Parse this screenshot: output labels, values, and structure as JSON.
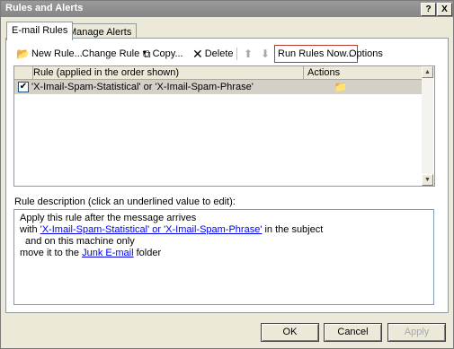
{
  "window": {
    "title": "Rules and Alerts",
    "help_label": "?",
    "close_label": "X"
  },
  "tabs": [
    {
      "label": "E-mail Rules",
      "active": true
    },
    {
      "label": "Manage Alerts",
      "active": false
    }
  ],
  "toolbar": {
    "new_rule": "New Rule...",
    "change_rule": "Change Rule",
    "copy": "Copy...",
    "delete": "Delete",
    "run_rules_now": "Run Rules Now...",
    "options": "Options"
  },
  "rules_list": {
    "columns": [
      "Rule (applied in the order shown)",
      "Actions"
    ],
    "rows": [
      {
        "checked": true,
        "rule": "'X-Imail-Spam-Statistical' or 'X-Imail-Spam-Phrase'"
      }
    ]
  },
  "description": {
    "label": "Rule description (click an underlined value to edit):",
    "line1": "Apply this rule after the message arrives",
    "line2_prefix": "with ",
    "line2_link": "'X-Imail-Spam-Statistical' or 'X-Imail-Spam-Phrase'",
    "line2_suffix": " in the subject",
    "line3": "and on this machine only",
    "line4_prefix": "move it to the ",
    "line4_link": "Junk E-mail",
    "line4_suffix": " folder"
  },
  "buttons": {
    "ok": "OK",
    "cancel": "Cancel",
    "apply": "Apply"
  },
  "icons": {
    "new_rule": "new-rule-icon",
    "copy": "copy-icon",
    "delete": "delete-icon",
    "move_up": "up-arrow-icon",
    "move_down": "down-arrow-icon",
    "action": "move-to-folder-icon"
  }
}
